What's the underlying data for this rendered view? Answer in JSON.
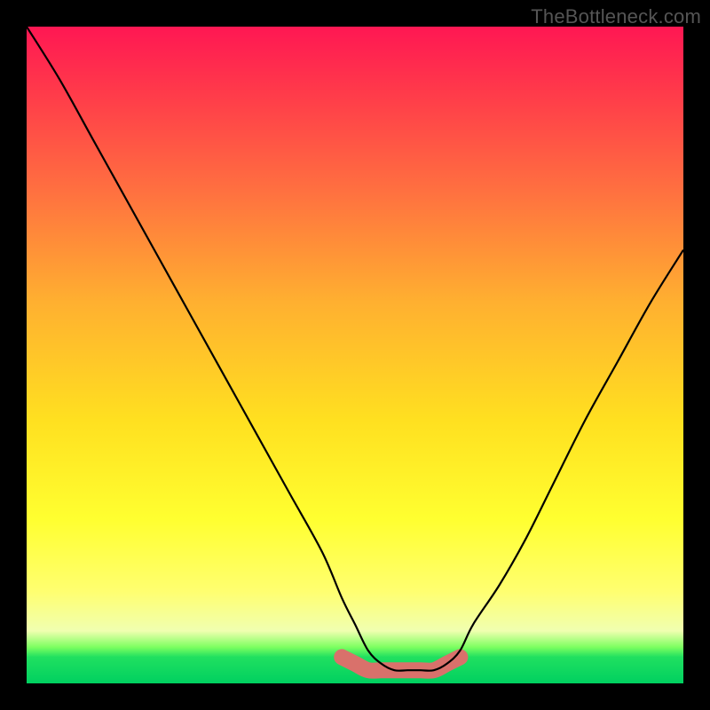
{
  "watermark": "TheBottleneck.com",
  "chart_data": {
    "type": "line",
    "title": "",
    "xlabel": "",
    "ylabel": "",
    "xlim": [
      0,
      100
    ],
    "ylim": [
      0,
      100
    ],
    "grid": false,
    "series": [
      {
        "name": "main-curve",
        "color": "#000000",
        "x": [
          0,
          5,
          10,
          15,
          20,
          25,
          30,
          35,
          40,
          45,
          48,
          50,
          52,
          54,
          56,
          58,
          60,
          62,
          64,
          66,
          68,
          72,
          76,
          80,
          85,
          90,
          95,
          100
        ],
        "values": [
          100,
          92,
          83,
          74,
          65,
          56,
          47,
          38,
          29,
          20,
          13,
          9,
          5,
          3,
          2,
          2,
          2,
          2,
          3,
          5,
          9,
          15,
          22,
          30,
          40,
          49,
          58,
          66
        ]
      },
      {
        "name": "highlight-band",
        "color": "#d9716b",
        "x": [
          48,
          50,
          52,
          54,
          56,
          58,
          60,
          62,
          64,
          66
        ],
        "values": [
          4,
          3,
          2,
          2,
          2,
          2,
          2,
          2,
          3,
          4
        ]
      }
    ],
    "background_gradient": {
      "direction": "vertical",
      "stops": [
        {
          "pos": 0.0,
          "color": "#ff1753"
        },
        {
          "pos": 0.1,
          "color": "#ff3a4a"
        },
        {
          "pos": 0.25,
          "color": "#ff7040"
        },
        {
          "pos": 0.42,
          "color": "#ffb030"
        },
        {
          "pos": 0.6,
          "color": "#ffe020"
        },
        {
          "pos": 0.75,
          "color": "#ffff30"
        },
        {
          "pos": 0.86,
          "color": "#ffff70"
        },
        {
          "pos": 0.92,
          "color": "#f0ffb0"
        },
        {
          "pos": 0.945,
          "color": "#7cff60"
        },
        {
          "pos": 0.96,
          "color": "#20e060"
        },
        {
          "pos": 1.0,
          "color": "#00d060"
        }
      ]
    }
  }
}
